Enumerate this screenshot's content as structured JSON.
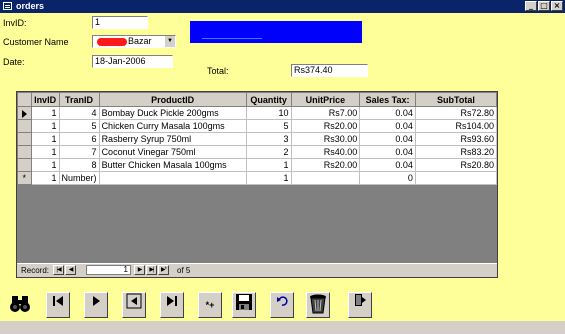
{
  "window": {
    "title": "orders",
    "min": "_",
    "max": "□",
    "close": "×"
  },
  "form": {
    "invid_label": "InvID:",
    "invid_value": "1",
    "customer_label": "Customer Name",
    "customer_value": "Bazar",
    "date_label": "Date:",
    "date_value": "18-Jan-2006",
    "total_label": "Total:",
    "total_value": "Rs374.40"
  },
  "grid": {
    "columns": [
      "InvID",
      "TranID",
      "ProductID",
      "Quantity",
      "UnitPrice",
      "Sales Tax:",
      "SubTotal"
    ],
    "rows": [
      [
        "1",
        "4",
        "Bombay Duck Pickle  200gms",
        "10",
        "Rs7.00",
        "0.04",
        "Rs72.80"
      ],
      [
        "1",
        "5",
        "Chicken Curry Masala 100gms",
        "5",
        "Rs20.00",
        "0.04",
        "Rs104.00"
      ],
      [
        "1",
        "6",
        "Rasberry Syrup 750ml",
        "3",
        "Rs30.00",
        "0.04",
        "Rs93.60"
      ],
      [
        "1",
        "7",
        "Coconut Vinegar 750ml",
        "2",
        "Rs40.00",
        "0.04",
        "Rs83.20"
      ],
      [
        "1",
        "8",
        "Butter Chicken Masala 100gms",
        "1",
        "Rs20.00",
        "0.04",
        "Rs20.80"
      ]
    ],
    "new_row": [
      "1",
      "Number)",
      "",
      "1",
      "",
      "0",
      ""
    ],
    "new_row_marker": "*"
  },
  "record_nav": {
    "label": "Record:",
    "current": "1",
    "of_label": "of",
    "total": "5"
  },
  "toolbar": {
    "add_label": "*+"
  }
}
